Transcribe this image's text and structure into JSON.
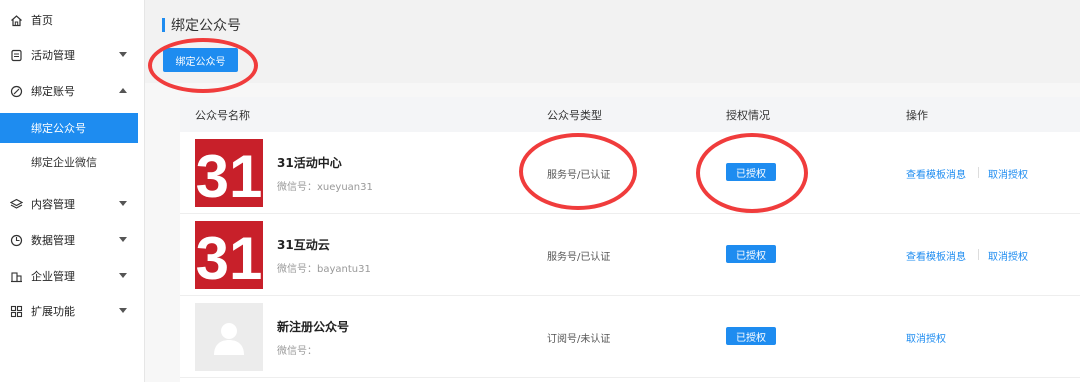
{
  "sidebar": {
    "items": [
      {
        "label": "首页",
        "icon": "home-icon"
      },
      {
        "label": "活动管理",
        "icon": "activity-icon"
      },
      {
        "label": "绑定账号",
        "icon": "link-icon"
      },
      {
        "label": "内容管理",
        "icon": "layers-icon"
      },
      {
        "label": "数据管理",
        "icon": "chart-icon"
      },
      {
        "label": "企业管理",
        "icon": "building-icon"
      },
      {
        "label": "扩展功能",
        "icon": "grid-icon"
      }
    ],
    "sub_items": [
      {
        "label": "绑定公众号",
        "active": true
      },
      {
        "label": "绑定企业微信",
        "active": false
      }
    ]
  },
  "main": {
    "title": "绑定公众号",
    "bind_button": "绑定公众号",
    "table": {
      "headers": [
        "公众号名称",
        "公众号类型",
        "授权情况",
        "操作"
      ],
      "rows": [
        {
          "logo": "31",
          "name": "31活动中心",
          "wechat": "微信号：xueyuan31",
          "type": "服务号/已认证",
          "status": "已授权",
          "ops": [
            "查看模板消息",
            "取消授权"
          ]
        },
        {
          "logo": "31",
          "name": "31互动云",
          "wechat": "微信号：bayantu31",
          "type": "服务号/已认证",
          "status": "已授权",
          "ops": [
            "查看模板消息",
            "取消授权"
          ]
        },
        {
          "logo": "",
          "name": "新注册公众号",
          "wechat": "微信号：",
          "type": "订阅号/未认证",
          "status": "已授权",
          "ops": [
            "取消授权"
          ]
        }
      ]
    }
  },
  "colors": {
    "accent": "#1e8cf0",
    "annotation": "#f03c3c",
    "logo_red": "#c8202a"
  }
}
